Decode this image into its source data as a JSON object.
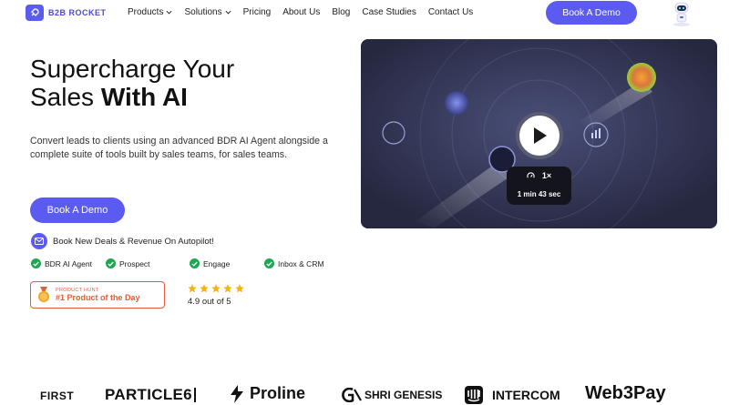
{
  "nav": {
    "logo_text": "B2B ROCKET",
    "links": [
      {
        "label": "Products",
        "dropdown": true
      },
      {
        "label": "Solutions",
        "dropdown": true
      },
      {
        "label": "Pricing",
        "dropdown": false
      },
      {
        "label": "About Us",
        "dropdown": false
      },
      {
        "label": "Blog",
        "dropdown": false
      },
      {
        "label": "Case Studies",
        "dropdown": false
      },
      {
        "label": "Contact Us",
        "dropdown": false
      }
    ],
    "cta": "Book A Demo"
  },
  "hero": {
    "title_line1": "Supercharge Your",
    "title_line2_plain": "Sales ",
    "title_line2_bold": "With AI",
    "description": "Convert leads to clients using an advanced BDR AI Agent alongside a complete suite of tools built by sales teams, for sales teams.",
    "cta": "Book A Demo",
    "autopilot": "Book New Deals & Revenue On Autopilot!",
    "features": [
      "BDR AI Agent",
      "Prospect",
      "Engage",
      "Inbox & CRM"
    ]
  },
  "product_hunt": {
    "label": "PRODUCT HUNT",
    "title": "#1 Product of the Day"
  },
  "rating": {
    "stars": 5,
    "text": "4.9 out of 5"
  },
  "video": {
    "speed": "1×",
    "duration": "1 min 43 sec"
  },
  "logos": [
    "FIRST",
    "PARTICLE6",
    "Proline",
    "SHRI GENESIS",
    "INTERCOM",
    "Web3Pay"
  ],
  "colors": {
    "primary": "#5b5bf0",
    "check_green": "#22a553",
    "product_hunt": "#e55c3c",
    "star": "#f6b40e"
  }
}
